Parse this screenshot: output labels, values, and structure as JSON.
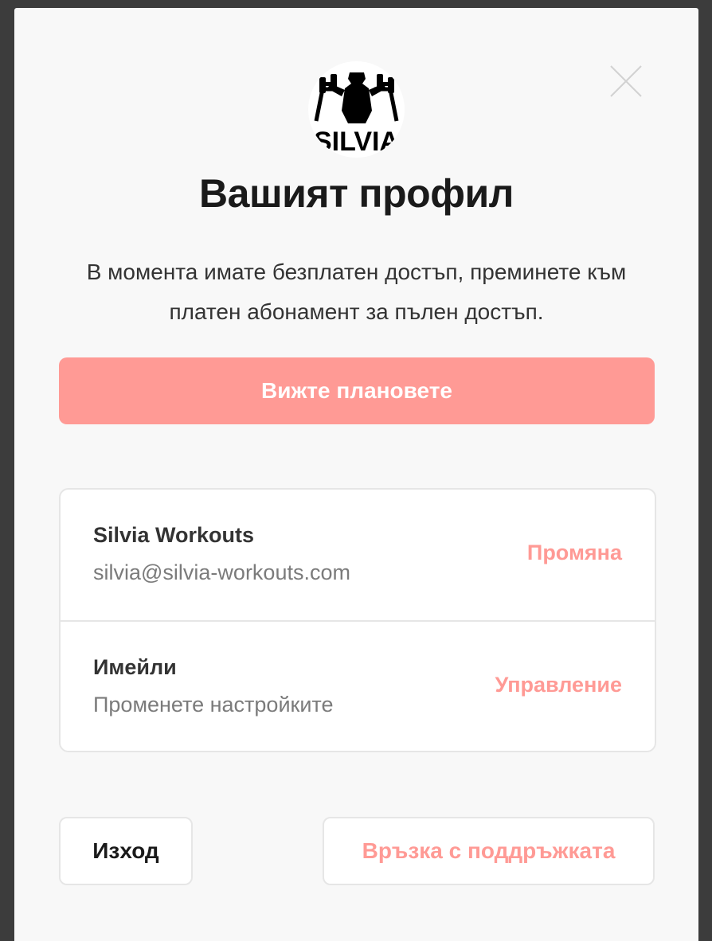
{
  "modal": {
    "title": "Вашият профил",
    "subtitle": "В момента имате безплатен достъп, преминете към платен абонамент за пълен достъп.",
    "logo": {
      "icon": "silvia-workouts-logo",
      "text": "SILVIA"
    },
    "close_icon": "close-icon",
    "plans_button_label": "Вижте плановете"
  },
  "account": {
    "name": "Silvia Workouts",
    "email": "silvia@silvia-workouts.com",
    "action_label": "Промяна"
  },
  "emails": {
    "title": "Имейли",
    "subtitle": "Променете настройките",
    "action_label": "Управление"
  },
  "footer": {
    "logout_label": "Изход",
    "support_label": "Връзка с поддръжката"
  },
  "colors": {
    "accent": "#ff9a95",
    "background": "#f8f8f8",
    "border": "#e6e6e6",
    "text_dark": "#1a1a1a",
    "text_muted": "#7b7b7b"
  }
}
